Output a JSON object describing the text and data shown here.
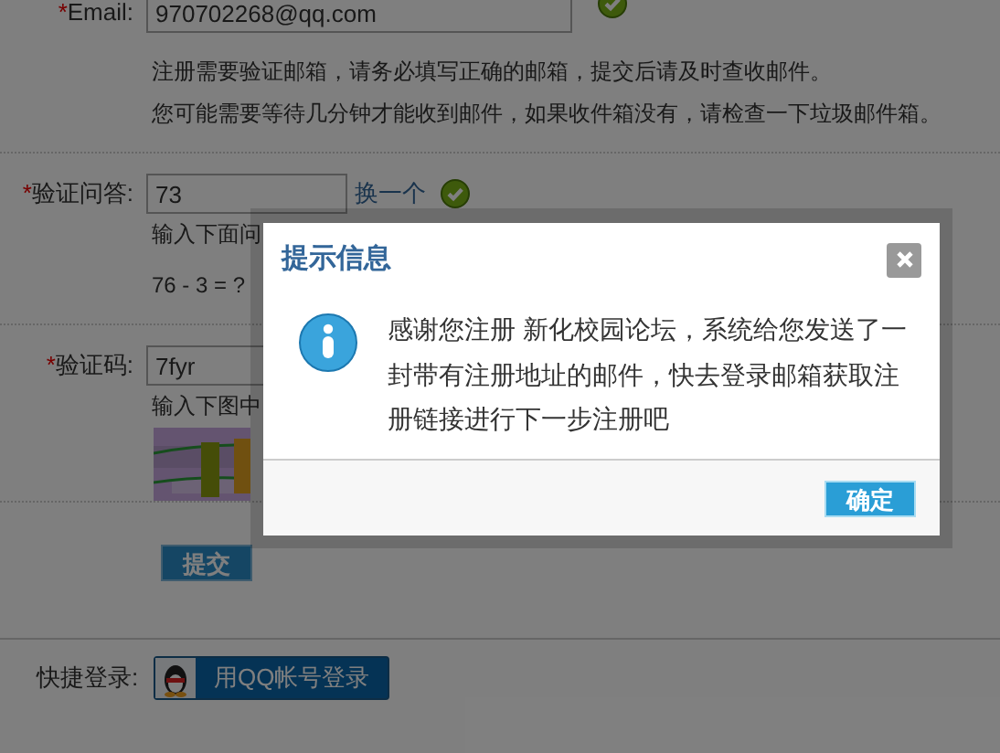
{
  "form": {
    "fields": [
      {
        "kind": "email",
        "label": "Email:",
        "mark": "*",
        "value": "970702268@qq.com",
        "valid": true,
        "help": [
          "注册需要验证邮箱，请务必填写正确的邮箱，提交后请及时查收邮件。",
          "您可能需要等待几分钟才能收到邮件，如果收件箱没有，请检查一下垃圾邮件箱。"
        ]
      },
      {
        "kind": "question",
        "label": "验证问答:",
        "mark": "*",
        "value": "73",
        "link": "换一个",
        "valid": true,
        "help": [
          "输入下面问",
          "76 - 3 = ?"
        ]
      },
      {
        "kind": "captcha",
        "label": "验证码:",
        "mark": "*",
        "value": "7fyr",
        "valid": false,
        "help": [
          "输入下图中"
        ]
      }
    ],
    "submit": "提交"
  },
  "quick_login": {
    "label": "快捷登录:",
    "button": "用QQ帐号登录"
  },
  "dialog": {
    "title": "提示信息",
    "message": "感谢您注册 新化校园论坛，系统给您发送了一封带有注册地址的邮件，快去登录邮箱获取注册链接进行下一步注册吧",
    "ok_button": "确定"
  }
}
